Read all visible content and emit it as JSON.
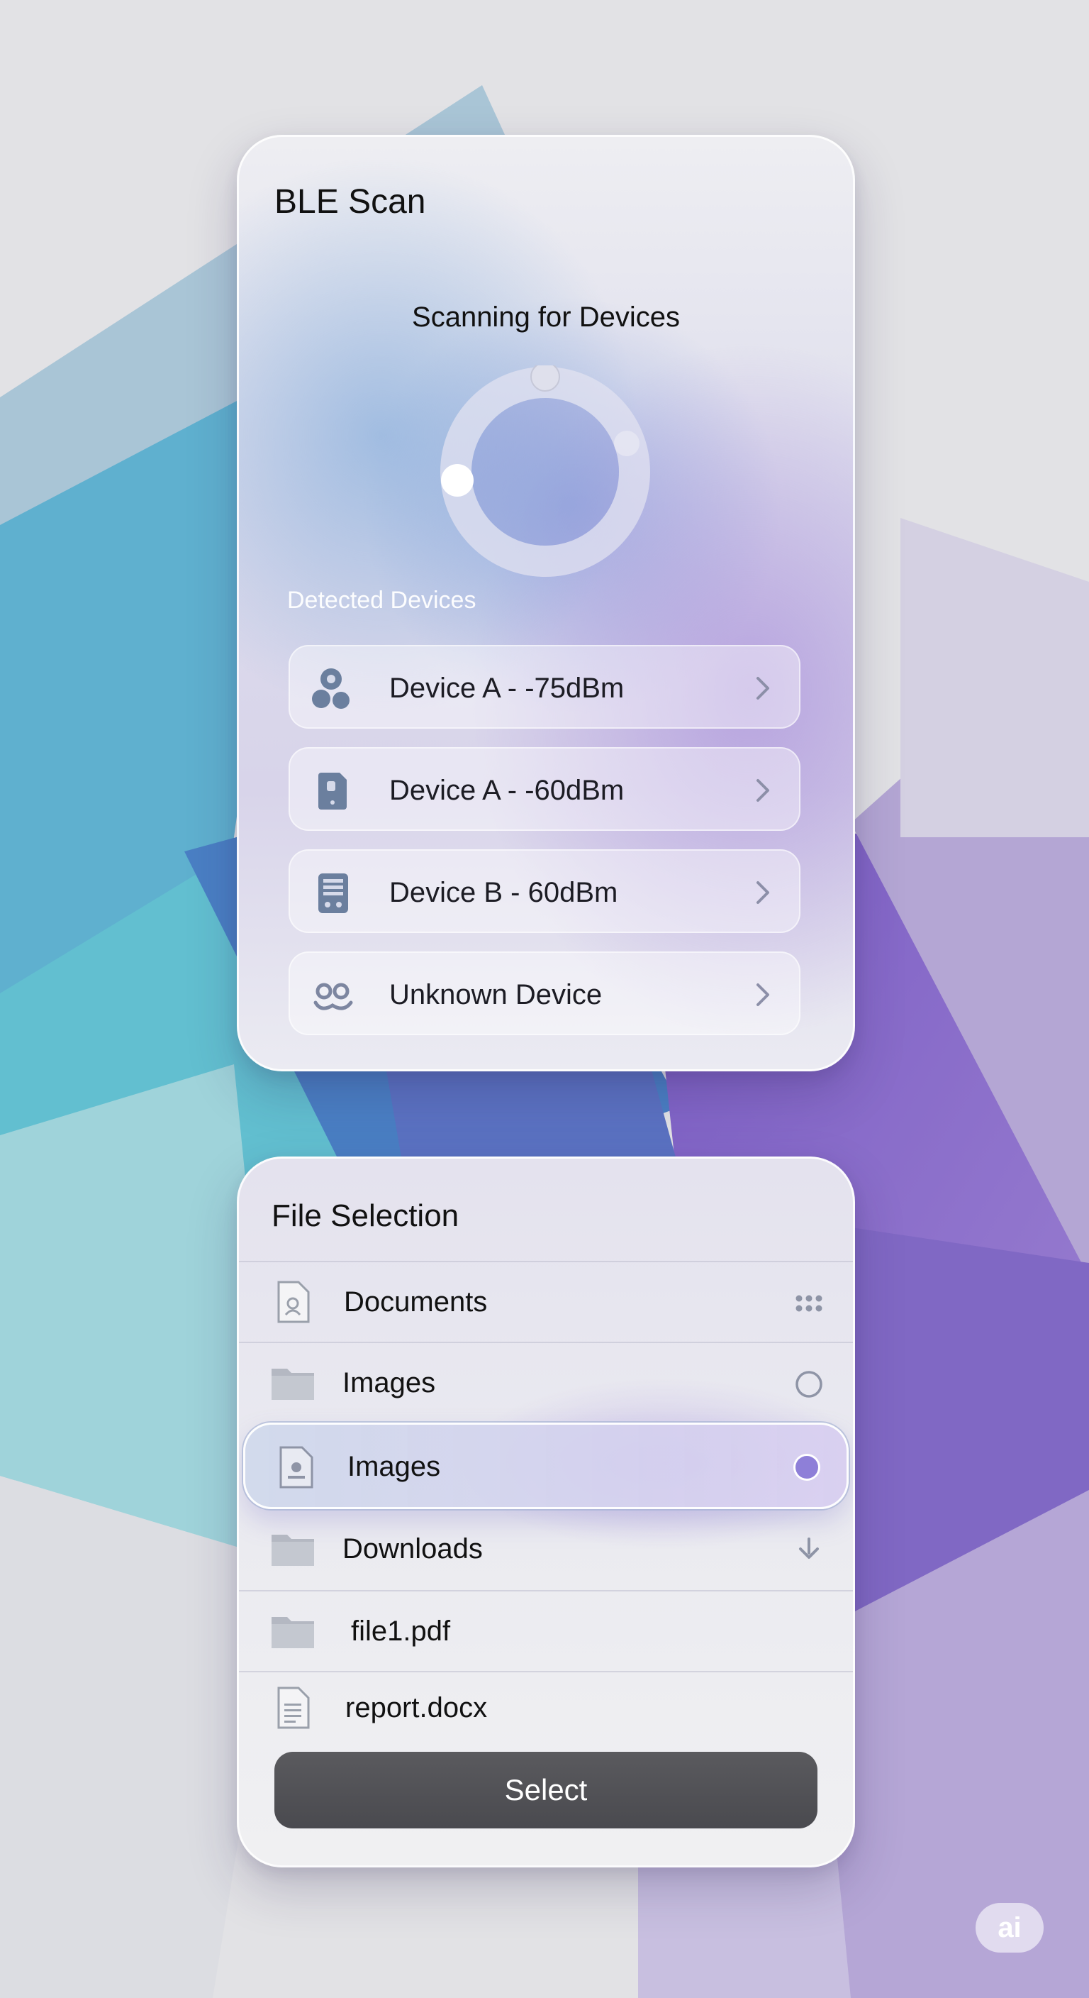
{
  "ble": {
    "title": "BLE Scan",
    "scan_title": "Scanning for Devices",
    "detected_label": "Detected Devices",
    "devices": [
      {
        "label": "Device A - -75dBm",
        "icon": "bluetooth-cluster-icon"
      },
      {
        "label": "Device A - -60dBm",
        "icon": "phone-icon"
      },
      {
        "label": "Device B - 60dBm",
        "icon": "tablet-icon"
      },
      {
        "label": "Unknown Device",
        "icon": "unknown-device-icon"
      }
    ]
  },
  "files": {
    "title": "File Selection",
    "items": [
      {
        "label": "Documents",
        "icon": "document-icon",
        "right": "grid-dots-icon",
        "selected": false
      },
      {
        "label": "Images",
        "icon": "folder-icon",
        "right": "radio-empty-icon",
        "selected": false
      },
      {
        "label": "Images",
        "icon": "image-file-icon",
        "right": "radio-filled-icon",
        "selected": true
      },
      {
        "label": "Downloads",
        "icon": "folder-icon",
        "right": "download-icon",
        "selected": false
      },
      {
        "label": "file1.pdf",
        "icon": "folder-icon",
        "right": "",
        "selected": false
      },
      {
        "label": "report.docx",
        "icon": "text-file-icon",
        "right": "",
        "selected": false
      }
    ],
    "select_label": "Select"
  },
  "badge": {
    "label": "ai"
  },
  "colors": {
    "accent": "#8e7fd8",
    "icon_blue_gray": "#6b7f9e",
    "icon_gray": "#9aa0ab",
    "button_dark": "#525256"
  }
}
